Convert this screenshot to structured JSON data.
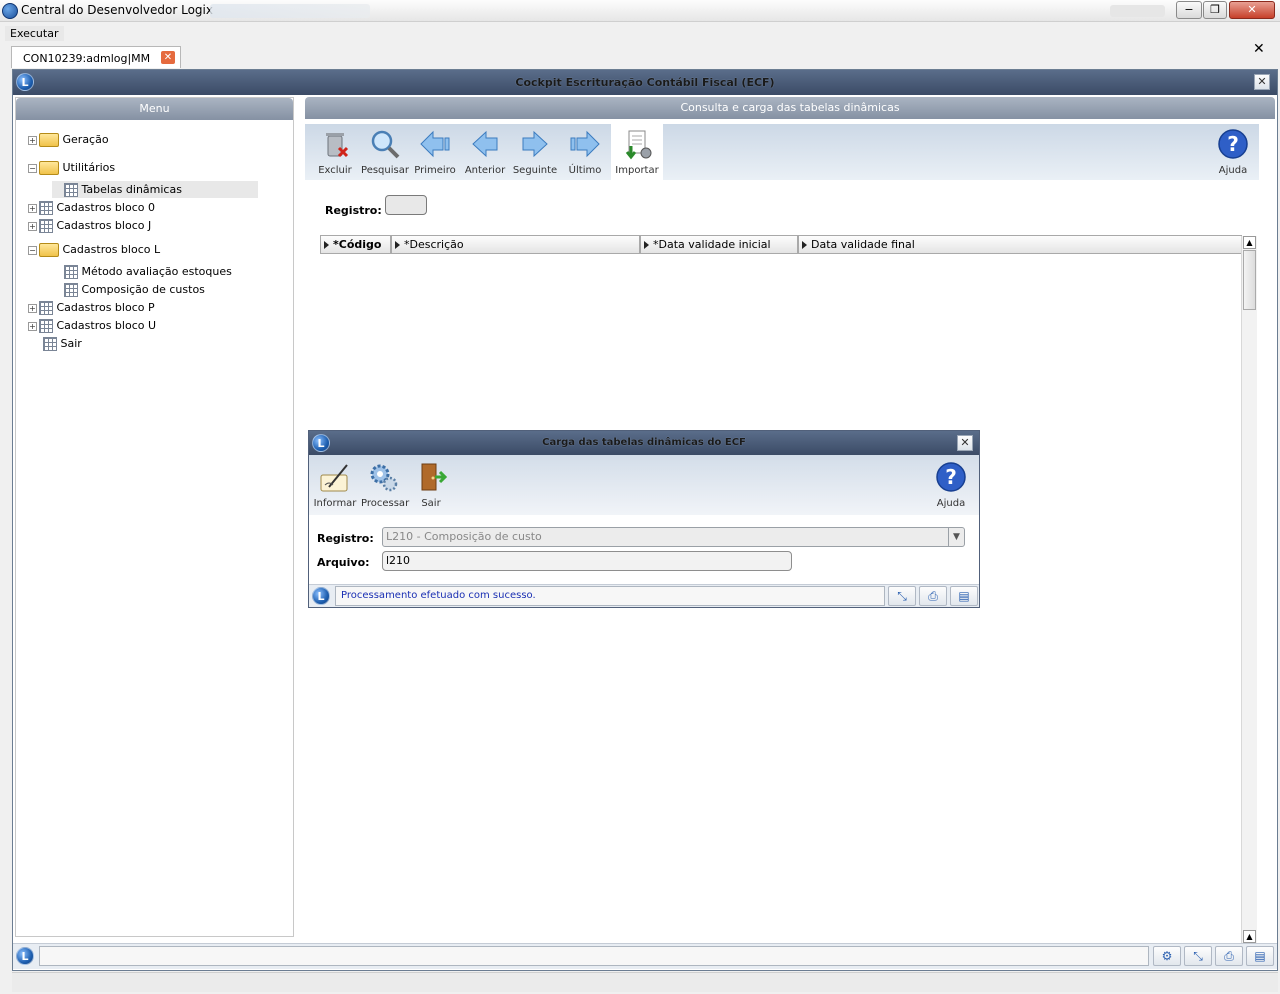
{
  "window": {
    "title": "Central do Desenvolvedor Logix",
    "minimize": "−",
    "restore": "❐",
    "close": "✕"
  },
  "menubar": {
    "executar": "Executar"
  },
  "tab": {
    "label": "CON10239:admlog|MM",
    "close": "✕"
  },
  "close_all": "✕",
  "mdi": {
    "title": "Cockpit Escrituração Contábil Fiscal (ECF)",
    "close": "✕",
    "menu_header": "Menu",
    "content_header": "Consulta e carga das tabelas dinâmicas"
  },
  "tree": [
    {
      "label": "Geração"
    },
    {
      "label": "Utilitários"
    },
    {
      "label": "Tabelas dinâmicas"
    },
    {
      "label": "Cadastros bloco 0"
    },
    {
      "label": "Cadastros bloco J"
    },
    {
      "label": "Cadastros bloco L"
    },
    {
      "label": "Método avaliação estoques"
    },
    {
      "label": "Composição de custos"
    },
    {
      "label": "Cadastros bloco P"
    },
    {
      "label": "Cadastros bloco U"
    },
    {
      "label": "Sair"
    }
  ],
  "toolbar": {
    "excluir": "Excluir",
    "pesquisar": "Pesquisar",
    "primeiro": "Primeiro",
    "anterior": "Anterior",
    "seguinte": "Seguinte",
    "ultimo": "Último",
    "importar": "Importar",
    "ajuda": "Ajuda"
  },
  "registro_label": "Registro:",
  "columns": [
    "*Código",
    "*Descrição",
    "*Data validade inicial",
    "Data validade final"
  ],
  "dialog": {
    "title": "Carga das tabelas dinâmicas do ECF",
    "close": "✕",
    "toolbar": {
      "informar": "Informar",
      "processar": "Processar",
      "sair": "Sair",
      "ajuda": "Ajuda"
    },
    "registro_label": "Registro:",
    "registro_value": "L210 - Composição de custo",
    "arquivo_label": "Arquivo:",
    "arquivo_value": "l210",
    "status_message": "Processamento efetuado com sucesso."
  },
  "colors": {
    "title_bar": "#3b4b66",
    "toolbar_bg": "#ccd8e6",
    "status_text": "#1a2fb3"
  }
}
